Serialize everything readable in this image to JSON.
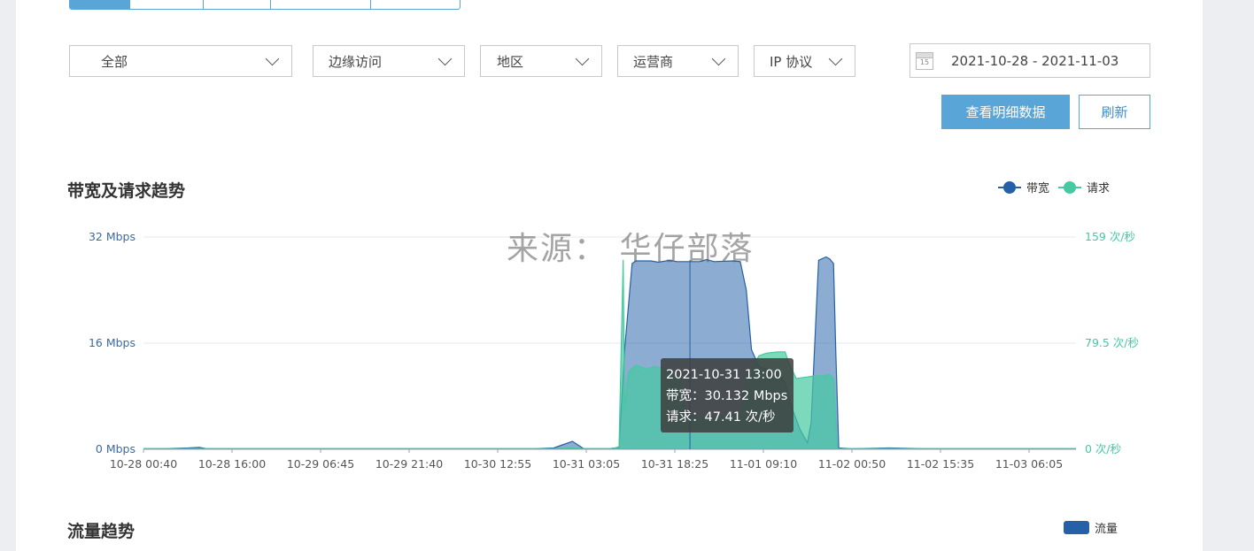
{
  "filters": {
    "scope": {
      "value": "全部"
    },
    "access": {
      "value": "边缘访问"
    },
    "region": {
      "value": "地区"
    },
    "isp": {
      "value": "运营商"
    },
    "protocol": {
      "value": "IP 协议"
    },
    "date_range": {
      "value": "2021-10-28 - 2021-11-03",
      "calendar_icon_day": "15"
    }
  },
  "buttons": {
    "detail": "查看明细数据",
    "refresh": "刷新"
  },
  "colors": {
    "accent": "#5aa5d8",
    "bandwidth": "#2560a8",
    "requests": "#45c9a0"
  },
  "section1": {
    "title": "带宽及请求趋势",
    "legend": [
      "带宽",
      "请求"
    ]
  },
  "watermark": "来源： 华仔部落",
  "tooltip": {
    "time": "2021-10-31 13:00",
    "bandwidth_line": "带宽：30.132 Mbps",
    "requests_line": "请求：47.41 次/秒"
  },
  "section2": {
    "title": "流量趋势",
    "legend": "流量"
  },
  "chart_data": {
    "type": "area",
    "x_tick_labels": [
      "10-28 00:40",
      "10-28 16:00",
      "10-29 06:45",
      "10-29 21:40",
      "10-30 12:55",
      "10-31 03:05",
      "10-31 18:25",
      "11-01 09:10",
      "11-02 00:50",
      "11-02 15:35",
      "11-03 06:05"
    ],
    "left_axis": {
      "ticks": [
        "0 Mbps",
        "16 Mbps",
        "32 Mbps"
      ],
      "range": [
        0,
        32
      ],
      "unit": "Mbps"
    },
    "right_axis": {
      "ticks": [
        "0 次/秒",
        "79.5 次/秒",
        "159 次/秒"
      ],
      "range": [
        0,
        159
      ],
      "unit": "次/秒"
    },
    "grid": true,
    "legend_position": "top-right",
    "series": [
      {
        "name": "带宽",
        "axis": "left",
        "points": [
          [
            0,
            0.1
          ],
          [
            5,
            0.1
          ],
          [
            12,
            0.2
          ],
          [
            15,
            0.3
          ],
          [
            17,
            0.1
          ],
          [
            30,
            0.1
          ],
          [
            60,
            0.1
          ],
          [
            95,
            0.1
          ],
          [
            104.4,
            0.1
          ],
          [
            110,
            0.2
          ],
          [
            115,
            1.2
          ],
          [
            118,
            0.1
          ],
          [
            125,
            0.1
          ],
          [
            127.5,
            0.3
          ],
          [
            129,
            15
          ],
          [
            131,
            28
          ],
          [
            132,
            28.4
          ],
          [
            136,
            28.4
          ],
          [
            138,
            28.2
          ],
          [
            141,
            28.5
          ],
          [
            143,
            28.3
          ],
          [
            149,
            28.3
          ],
          [
            151,
            28.6
          ],
          [
            153,
            28.3
          ],
          [
            158,
            28.4
          ],
          [
            160,
            28.3
          ],
          [
            161.6,
            24
          ],
          [
            163,
            15
          ],
          [
            165,
            12.5
          ],
          [
            170,
            11.5
          ],
          [
            172,
            10
          ],
          [
            174,
            6
          ],
          [
            176,
            3
          ],
          [
            178,
            1
          ],
          [
            179,
            4
          ],
          [
            180.8,
            26
          ],
          [
            181,
            28.5
          ],
          [
            183,
            29
          ],
          [
            184,
            28.7
          ],
          [
            185,
            28
          ],
          [
            185.6,
            15
          ],
          [
            186.4,
            0.2
          ],
          [
            190,
            0.1
          ],
          [
            200,
            0.2
          ],
          [
            210,
            0.1
          ],
          [
            225,
            0.1
          ],
          [
            245,
            0.1
          ],
          [
            250,
            0.1
          ]
        ]
      },
      {
        "name": "请求",
        "axis": "right",
        "points": [
          [
            0,
            0.5
          ],
          [
            20,
            0.5
          ],
          [
            40,
            0.5
          ],
          [
            60,
            0.5
          ],
          [
            80,
            0.5
          ],
          [
            100,
            0.5
          ],
          [
            104.4,
            0.5
          ],
          [
            111,
            0.5
          ],
          [
            115,
            1
          ],
          [
            118,
            0.5
          ],
          [
            126,
            0.5
          ],
          [
            127.5,
            2
          ],
          [
            128.6,
            142
          ],
          [
            129,
            30
          ],
          [
            130,
            58
          ],
          [
            132,
            63
          ],
          [
            135,
            60
          ],
          [
            137,
            62
          ],
          [
            140,
            60
          ],
          [
            142,
            57
          ],
          [
            144,
            53
          ],
          [
            145.5,
            25
          ],
          [
            150,
            24
          ],
          [
            156,
            25
          ],
          [
            160,
            26
          ],
          [
            162,
            55
          ],
          [
            165,
            70
          ],
          [
            167,
            72
          ],
          [
            170,
            73
          ],
          [
            172,
            73
          ],
          [
            173,
            65
          ],
          [
            175,
            53
          ],
          [
            180,
            55
          ],
          [
            182,
            55
          ],
          [
            184,
            56
          ],
          [
            185,
            53
          ],
          [
            186,
            0.5
          ],
          [
            195,
            0.5
          ],
          [
            210,
            0.5
          ],
          [
            230,
            0.5
          ],
          [
            250,
            0.5
          ]
        ]
      }
    ],
    "x_domain": [
      0,
      250
    ],
    "highlight_x": 146.5
  }
}
